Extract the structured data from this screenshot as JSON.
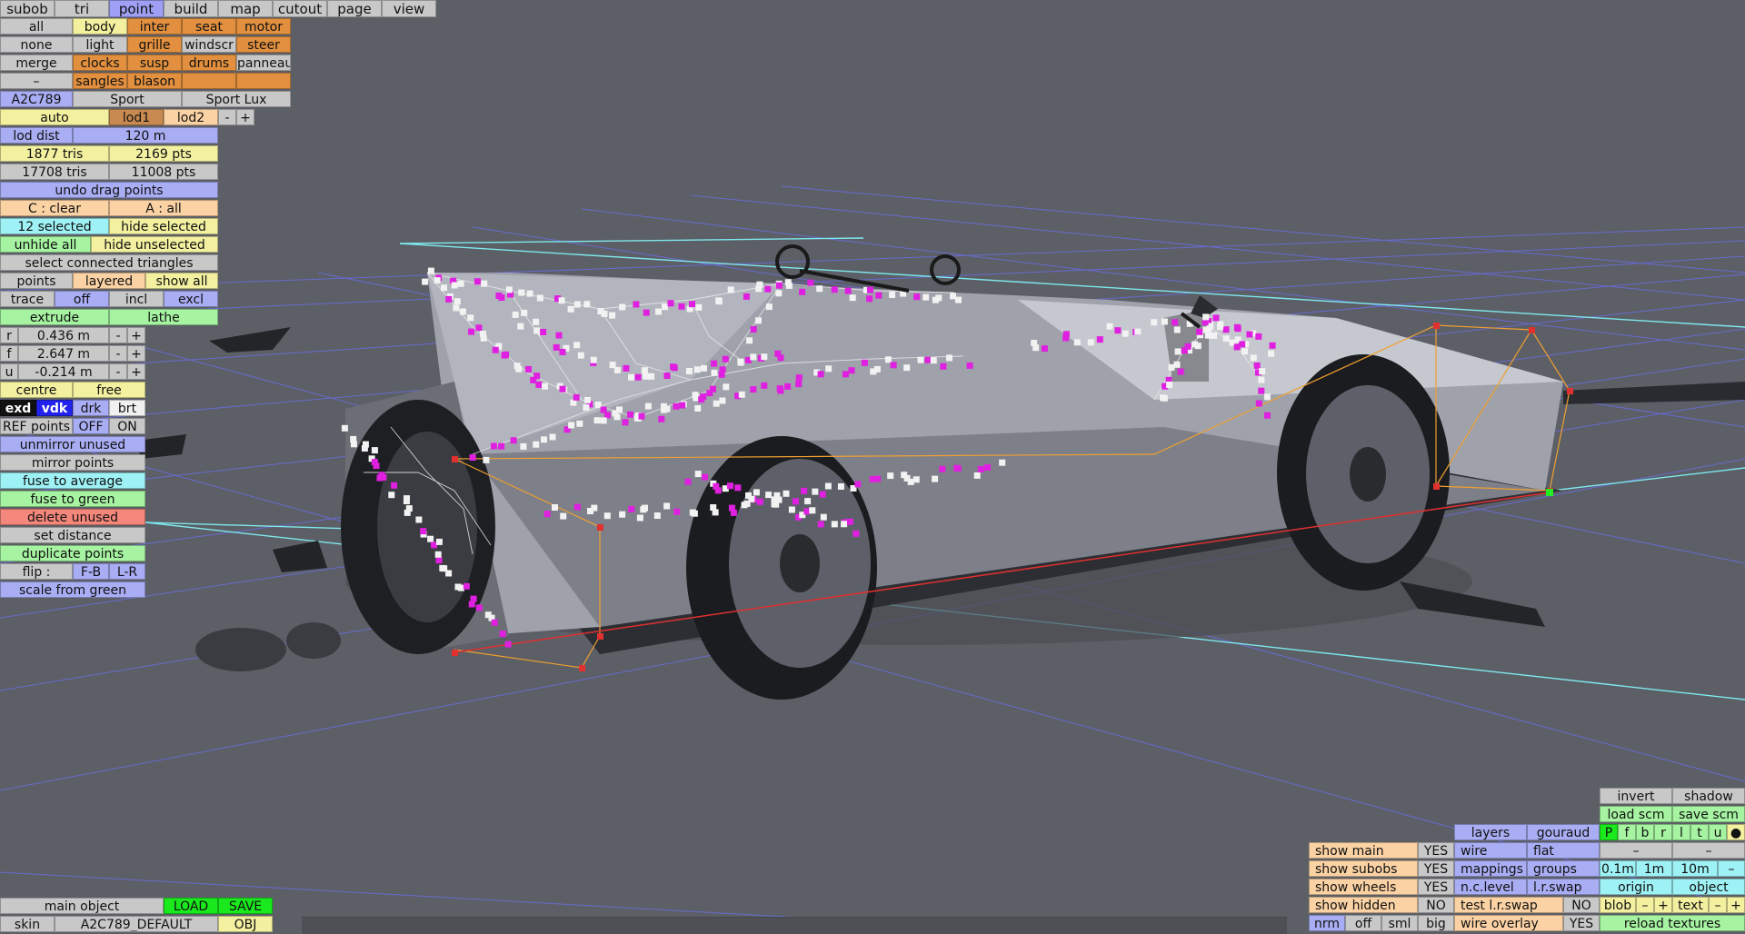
{
  "menu": {
    "tabs": [
      "subob",
      "tri",
      "point",
      "build",
      "map",
      "cutout",
      "page",
      "view"
    ],
    "active": "point"
  },
  "parts": {
    "col_select": [
      "all",
      "none",
      "merge",
      "–"
    ],
    "row1": [
      "body",
      "inter",
      "seat",
      "motor"
    ],
    "row2": [
      "light",
      "grille",
      "windscr",
      "steer"
    ],
    "row3": [
      "clocks",
      "susp",
      "drums",
      "panneau"
    ],
    "row4": [
      "sangles",
      "blason",
      "",
      ""
    ]
  },
  "variants": {
    "code": "A2C789",
    "v1": "Sport",
    "v2": "Sport Lux"
  },
  "lod": {
    "auto": "auto",
    "lod1": "lod1",
    "lod2": "lod2",
    "minus": "-",
    "plus": "+",
    "dist_label": "lod dist",
    "dist_value": "120 m",
    "tris1": "1877 tris",
    "pts1": "2169 pts",
    "tris2": "17708 tris",
    "pts2": "11008 pts"
  },
  "points": {
    "undo_drag": "undo drag points",
    "c_clear": "C : clear",
    "a_all": "A : all",
    "selected": "12 selected",
    "hide_selected": "hide selected",
    "unhide_all": "unhide all",
    "hide_unselected": "hide unselected",
    "select_connected": "select connected triangles",
    "points": "points",
    "layered": "layered",
    "show_all": "show all",
    "trace": "trace",
    "off": "off",
    "incl": "incl",
    "excl": "excl",
    "extrude": "extrude",
    "lathe": "lathe"
  },
  "coords": {
    "r_label": "r",
    "r_value": "0.436 m",
    "f_label": "f",
    "f_value": "2.647 m",
    "u_label": "u",
    "u_value": "-0.214 m",
    "minus": "-",
    "plus": "+"
  },
  "tools": {
    "centre": "centre",
    "free": "free",
    "exd": "exd",
    "vdk": "vdk",
    "drk": "drk",
    "brt": "brt",
    "ref_points": "REF points",
    "ref_off": "OFF",
    "ref_on": "ON",
    "unmirror_unused": "unmirror unused",
    "mirror_points": "mirror points",
    "fuse_average": "fuse to average",
    "fuse_green": "fuse to green",
    "delete_unused": "delete unused",
    "set_distance": "set distance",
    "duplicate_points": "duplicate points",
    "flip": "flip :",
    "flip_fb": "F-B",
    "flip_lr": "L-R",
    "scale_green": "scale from green"
  },
  "bottom_left": {
    "main_object": "main object",
    "load": "LOAD",
    "save": "SAVE",
    "skin": "skin",
    "skin_name": "A2C789_DEFAULT",
    "obj": "OBJ"
  },
  "display": {
    "show_main": "show main",
    "show_main_v": "YES",
    "show_subobs": "show subobs",
    "show_subobs_v": "YES",
    "show_wheels": "show wheels",
    "show_wheels_v": "YES",
    "show_hidden": "show hidden",
    "show_hidden_v": "NO",
    "nrm": "nrm",
    "off": "off",
    "sml": "sml",
    "big": "big",
    "layers": "layers",
    "gouraud": "gouraud",
    "wire": "wire",
    "flat": "flat",
    "mappings": "mappings",
    "groups": "groups",
    "nc_level": "n.c.level",
    "lr_swap": "l.r.swap",
    "test_lr_swap": "test l.r.swap",
    "test_lr_swap_v": "NO",
    "wire_overlay": "wire overlay",
    "wire_overlay_v": "YES",
    "invert": "invert",
    "shadow": "shadow",
    "load_scm": "load scm",
    "save_scm": "save scm",
    "flags": [
      "P",
      "f",
      "b",
      "r",
      "l",
      "t",
      "u",
      "●"
    ],
    "dash1": "–",
    "dash2": "–",
    "s01": "0.1m",
    "s1": "1m",
    "s10": "10m",
    "sdash": "–",
    "origin": "origin",
    "object": "object",
    "blob": "blob",
    "blob_minus": "–",
    "blob_plus": "+",
    "text": "text",
    "text_minus": "–",
    "text_plus": "+",
    "reload_textures": "reload textures"
  },
  "colors": {
    "background": "#5c5f66",
    "grid": "#6f6ff0",
    "axis": "#7fe8ee",
    "selection_point": "#e020e0",
    "point": "#f2f2f2"
  }
}
